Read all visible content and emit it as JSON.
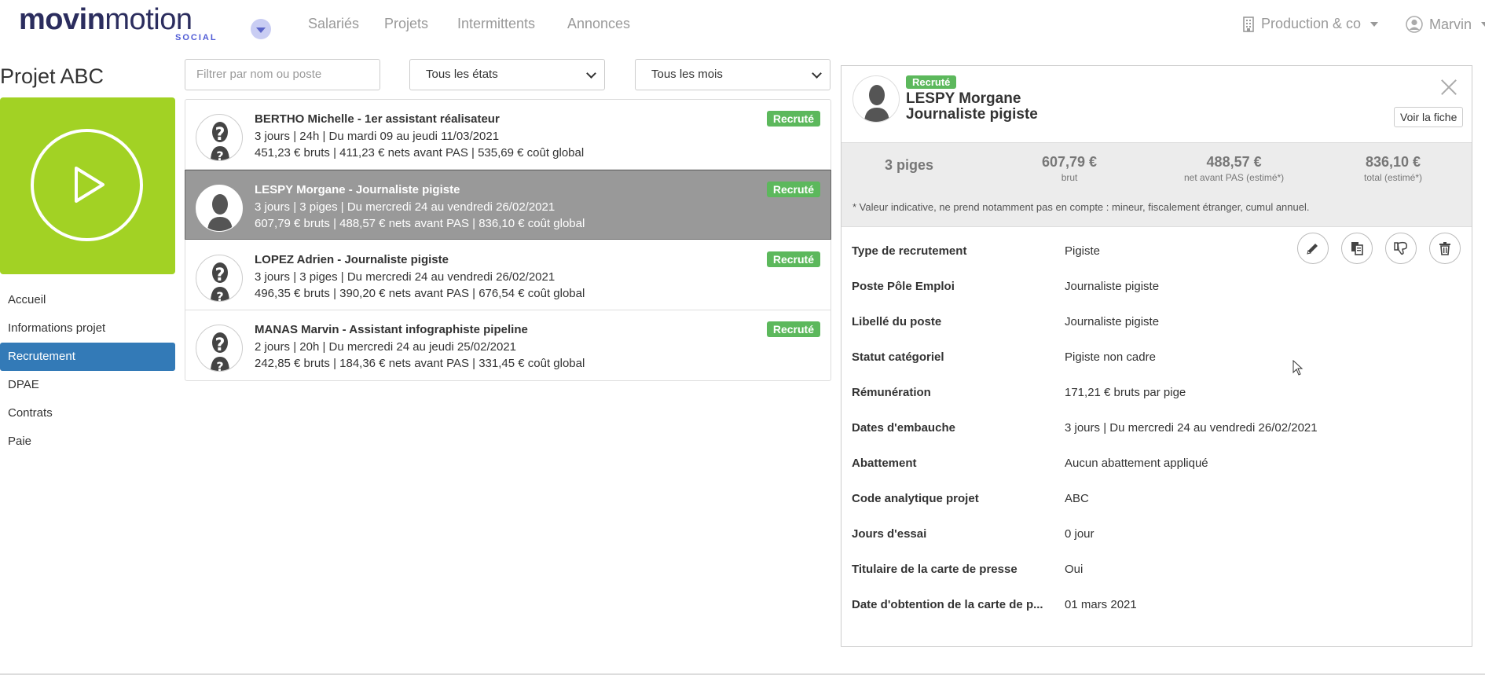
{
  "nav": {
    "logo_bold": "movin",
    "logo_light": "motion",
    "logo_sub": "SOCIAL",
    "links": [
      "Salariés",
      "Projets",
      "Intermittents",
      "Annonces"
    ],
    "company": "Production & co",
    "user": "Marvin"
  },
  "sidebar": {
    "project_title": "Projet ABC",
    "tile_color": "#a2d224",
    "items": [
      {
        "label": "Accueil",
        "active": false
      },
      {
        "label": "Informations projet",
        "active": false
      },
      {
        "label": "Recrutement",
        "active": true
      },
      {
        "label": "DPAE",
        "active": false
      },
      {
        "label": "Contrats",
        "active": false
      },
      {
        "label": "Paie",
        "active": false
      }
    ]
  },
  "filters": {
    "search_placeholder": "Filtrer par nom ou poste",
    "state_selected": "Tous les états",
    "month_selected": "Tous les mois"
  },
  "list": [
    {
      "title": "BERTHO Michelle - 1er assistant réalisateur",
      "line2": "3 jours | 24h | Du mardi 09 au jeudi 11/03/2021",
      "line3": "451,23 € bruts | 411,23 € nets avant PAS | 535,69 € coût global",
      "badge": "Recruté",
      "avatar": "unknown",
      "selected": false
    },
    {
      "title": "LESPY Morgane - Journaliste pigiste",
      "line2": "3 jours | 3 piges | Du mercredi 24 au vendredi 26/02/2021",
      "line3": "607,79 € bruts | 488,57 € nets avant PAS | 836,10 € coût global",
      "badge": "Recruté",
      "avatar": "person",
      "selected": true
    },
    {
      "title": "LOPEZ Adrien - Journaliste pigiste",
      "line2": "3 jours | 3 piges | Du mercredi 24 au vendredi 26/02/2021",
      "line3": "496,35 € bruts | 390,20 € nets avant PAS | 676,54 € coût global",
      "badge": "Recruté",
      "avatar": "unknown",
      "selected": false
    },
    {
      "title": "MANAS Marvin - Assistant infographiste pipeline",
      "line2": "2 jours | 20h | Du mercredi 24 au jeudi 25/02/2021",
      "line3": "242,85 € bruts | 184,36 € nets avant PAS | 331,45 € coût global",
      "badge": "Recruté",
      "avatar": "unknown",
      "selected": false
    }
  ],
  "detail": {
    "badge": "Recruté",
    "name": "LESPY Morgane",
    "role": "Journaliste pigiste",
    "voir_label": "Voir la fiche",
    "summary": {
      "piges": "3 piges",
      "brut_val": "607,79 €",
      "brut_lbl": "brut",
      "net_val": "488,57 €",
      "net_lbl": "net avant PAS (estimé*)",
      "total_val": "836,10 €",
      "total_lbl": "total (estimé*)",
      "note": "* Valeur indicative, ne prend notamment pas en compte : mineur, fiscalement étranger, cumul annuel."
    },
    "fields": [
      {
        "label": "Type de recrutement",
        "value": "Pigiste"
      },
      {
        "label": "Poste Pôle Emploi",
        "value": "Journaliste pigiste"
      },
      {
        "label": "Libellé du poste",
        "value": "Journaliste pigiste"
      },
      {
        "label": "Statut catégoriel",
        "value": "Pigiste non cadre"
      },
      {
        "label": "Rémunération",
        "value": "171,21 € bruts par pige"
      },
      {
        "label": "Dates d'embauche",
        "value": "3 jours | Du mercredi 24 au vendredi 26/02/2021"
      },
      {
        "label": "Abattement",
        "value": "Aucun abattement appliqué"
      },
      {
        "label": "Code analytique projet",
        "value": "ABC"
      },
      {
        "label": "Jours d'essai",
        "value": "0 jour"
      },
      {
        "label": "Titulaire de la carte de presse",
        "value": "Oui"
      },
      {
        "label": "Date d'obtention de la carte de p...",
        "value": "01 mars 2021"
      }
    ],
    "actions": [
      "edit-icon",
      "copy-icon",
      "thumbs-down-icon",
      "trash-icon"
    ]
  },
  "colors": {
    "brand": "#2b2d5e",
    "accent": "#337ab7",
    "success": "#5cb85c",
    "selected_row": "#999999"
  }
}
